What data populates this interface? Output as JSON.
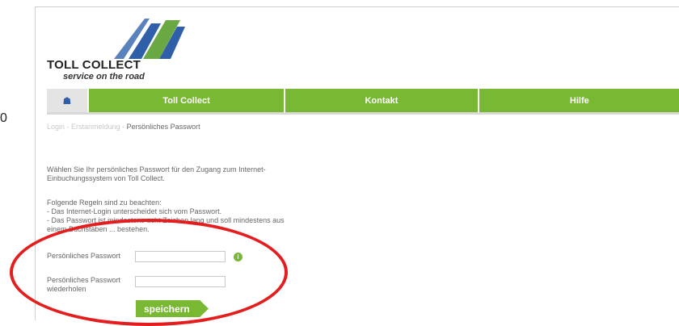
{
  "edge_digit": "0",
  "brand": {
    "name": "TOLL COLLECT",
    "slogan": "service on the road"
  },
  "nav": {
    "home_icon": "home-icon",
    "items": [
      "Toll Collect",
      "Kontakt",
      "Hilfe"
    ]
  },
  "breadcrumb": {
    "trail": "Login - Erstanmeldung - ",
    "current": "Persönliches Passwort"
  },
  "intro": {
    "line1": "Wählen Sie Ihr persönliches Passwort für den Zugang zum Internet-",
    "line2": "Einbuchungssystem von Toll Collect."
  },
  "rules": {
    "heading": "Folgende Regeln sind zu beachten:",
    "rule1": "- Das Internet-Login unterscheidet sich vom Passwort.",
    "rule2_line1": "- Das Passwort ist mindestens acht Zeichen lang und soll mindestens aus",
    "rule2_line2": "einem Buchstaben ... bestehen."
  },
  "form": {
    "password_label": "Persönliches Passwort",
    "repeat_label_line1": "Persönliches Passwort",
    "repeat_label_line2": "wiederholen",
    "password_value": "",
    "repeat_value": "",
    "info_icon": "info-icon",
    "info_glyph": "i",
    "save_label": "speichern"
  },
  "colors": {
    "accent_green": "#78b832",
    "highlight_red": "#e41e1e",
    "logo_blue": "#2f5fa8",
    "logo_green": "#6aa843"
  }
}
